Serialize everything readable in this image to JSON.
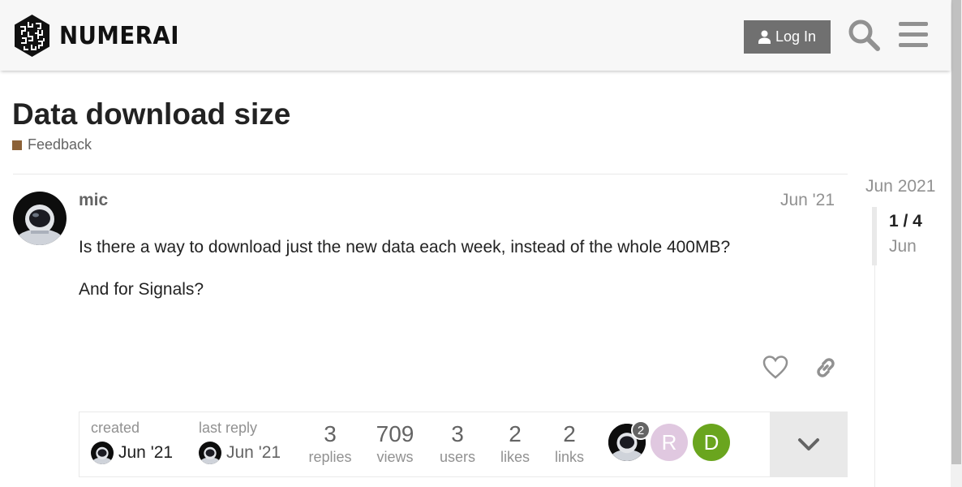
{
  "header": {
    "logo_text": "NUMERAI",
    "login_label": "Log In"
  },
  "topic": {
    "title": "Data download size",
    "category": "Feedback",
    "category_color": "#8C6238"
  },
  "post": {
    "username": "mic",
    "date": "Jun '21",
    "paragraphs": [
      "Is there a way to download just the new data each week, instead of the whole 400MB?",
      "And for Signals?"
    ]
  },
  "topic_map": {
    "created_label": "created",
    "created_date": "Jun '21",
    "last_reply_label": "last reply",
    "last_reply_date": "Jun '21",
    "stats": [
      {
        "value": "3",
        "label": "replies"
      },
      {
        "value": "709",
        "label": "views"
      },
      {
        "value": "3",
        "label": "users"
      },
      {
        "value": "2",
        "label": "likes"
      },
      {
        "value": "2",
        "label": "links"
      }
    ],
    "participants": [
      {
        "initial": "",
        "color": "#1a1a1a",
        "count": "2",
        "icon": "astronaut-avatar"
      },
      {
        "initial": "R",
        "color": "#e0c8e0",
        "count": ""
      },
      {
        "initial": "D",
        "color": "#6aa51e",
        "count": ""
      }
    ]
  },
  "timeline": {
    "start_date": "Jun 2021",
    "position": "1 / 4",
    "position_date": "Jun"
  },
  "icons": {
    "search": "search-icon",
    "menu": "hamburger-menu-icon",
    "like": "heart-icon",
    "link": "link-icon",
    "expand": "chevron-down-icon",
    "user": "user-icon"
  }
}
